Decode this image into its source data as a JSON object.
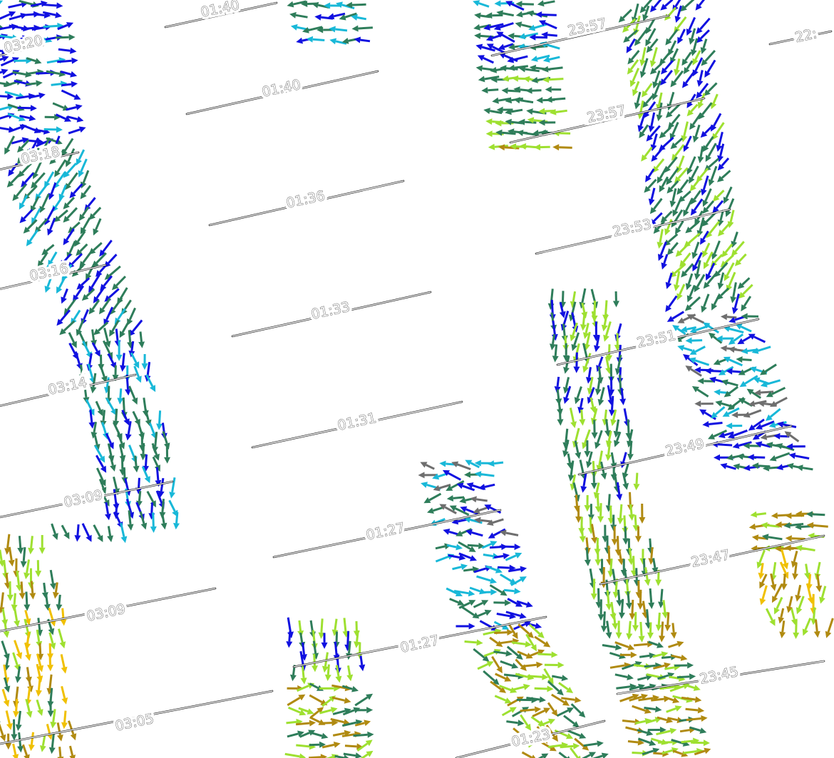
{
  "colors": {
    "blue": "#1010e0",
    "cyan": "#18b8d8",
    "green": "#2e7d5a",
    "lime": "#9ee030",
    "olive": "#b08a10",
    "yellow": "#f0c000",
    "gray": "#6e6e6e"
  },
  "tracks": [
    {
      "label": "03:20",
      "angle": -12
    },
    {
      "label": "03:18",
      "angle": -12
    },
    {
      "label": "03:16",
      "angle": -12
    },
    {
      "label": "03:14",
      "angle": -12
    },
    {
      "label": "03:09",
      "angle": -12
    },
    {
      "label": "03:09",
      "angle": -12
    },
    {
      "label": "03:05",
      "angle": -12
    },
    {
      "label": "01:40",
      "angle": -12
    },
    {
      "label": "01:40",
      "angle": -12
    },
    {
      "label": "01:36",
      "angle": -12
    },
    {
      "label": "01:33",
      "angle": -12
    },
    {
      "label": "01:31",
      "angle": -12
    },
    {
      "label": "01:27",
      "angle": -12
    },
    {
      "label": "01:27",
      "angle": -12
    },
    {
      "label": "01:23",
      "angle": -12
    },
    {
      "label": "23:57",
      "angle": -12
    },
    {
      "label": "23:57",
      "angle": -12
    },
    {
      "label": "23:53",
      "angle": -12
    },
    {
      "label": "23:51",
      "angle": -12
    },
    {
      "label": "23:49",
      "angle": -12
    },
    {
      "label": "23:47",
      "angle": -12
    },
    {
      "label": "23:45",
      "angle": -12
    },
    {
      "label": "22:",
      "angle": -12
    }
  ],
  "swaths": [
    {
      "name": "swath-left",
      "bands": [
        {
          "y": [
            0,
            200
          ],
          "dir": [
            -25,
            25
          ],
          "palette": [
            "blue",
            "blue",
            "cyan",
            "green"
          ]
        },
        {
          "y": [
            200,
            470
          ],
          "dir": [
            -140,
            -110
          ],
          "palette": [
            "green",
            "green",
            "blue",
            "cyan"
          ]
        },
        {
          "y": [
            470,
            760
          ],
          "dir": [
            -100,
            -60
          ],
          "palette": [
            "blue",
            "green",
            "green",
            "cyan"
          ]
        },
        {
          "y": [
            760,
            860
          ],
          "dir": [
            -100,
            -80
          ],
          "palette": [
            "lime",
            "olive",
            "green"
          ]
        },
        {
          "y": [
            860,
            1064
          ],
          "dir": [
            -100,
            -70
          ],
          "palette": [
            "green",
            "lime",
            "olive",
            "yellow"
          ]
        }
      ]
    },
    {
      "name": "swath-mid-top",
      "bands": [
        {
          "y": [
            0,
            80
          ],
          "dir": [
            160,
            200
          ],
          "palette": [
            "blue",
            "cyan",
            "green"
          ]
        }
      ]
    },
    {
      "name": "swath-center-top",
      "bands": [
        {
          "y": [
            0,
            90
          ],
          "dir": [
            150,
            200
          ],
          "palette": [
            "cyan",
            "green",
            "blue"
          ]
        },
        {
          "y": [
            90,
            200
          ],
          "dir": [
            170,
            190
          ],
          "palette": [
            "green",
            "green",
            "lime"
          ]
        },
        {
          "y": [
            200,
            225
          ],
          "dir": [
            170,
            190
          ],
          "palette": [
            "lime",
            "olive"
          ]
        }
      ]
    },
    {
      "name": "swath-right",
      "bands": [
        {
          "y": [
            0,
            440
          ],
          "dir": [
            -140,
            -100
          ],
          "palette": [
            "green",
            "green",
            "lime",
            "blue"
          ]
        },
        {
          "y": [
            440,
            620
          ],
          "dir": [
            140,
            220
          ],
          "palette": [
            "blue",
            "cyan",
            "green",
            "gray"
          ]
        },
        {
          "y": [
            620,
            740
          ],
          "dir": [
            160,
            200
          ],
          "palette": [
            "green",
            "blue"
          ]
        }
      ]
    },
    {
      "name": "swath-right-center",
      "bands": [
        {
          "y": [
            400,
            700
          ],
          "dir": [
            -110,
            -75
          ],
          "palette": [
            "green",
            "green",
            "lime",
            "blue"
          ]
        },
        {
          "y": [
            700,
            900
          ],
          "dir": [
            -95,
            -80
          ],
          "palette": [
            "lime",
            "olive",
            "green"
          ]
        },
        {
          "y": [
            900,
            1064
          ],
          "dir": [
            -20,
            20
          ],
          "palette": [
            "green",
            "lime",
            "olive"
          ]
        }
      ]
    },
    {
      "name": "swath-far-right",
      "bands": [
        {
          "y": [
            700,
            780
          ],
          "dir": [
            170,
            190
          ],
          "palette": [
            "lime",
            "green",
            "olive"
          ]
        },
        {
          "y": [
            780,
            900
          ],
          "dir": [
            -120,
            -60
          ],
          "palette": [
            "olive",
            "yellow",
            "lime"
          ]
        }
      ]
    },
    {
      "name": "swath-center-bottom",
      "bands": [
        {
          "y": [
            630,
            760
          ],
          "dir": [
            150,
            210
          ],
          "palette": [
            "green",
            "blue",
            "cyan",
            "gray"
          ]
        },
        {
          "y": [
            760,
            880
          ],
          "dir": [
            -40,
            30
          ],
          "palette": [
            "blue",
            "green",
            "cyan"
          ]
        },
        {
          "y": [
            880,
            1064
          ],
          "dir": [
            -60,
            30
          ],
          "palette": [
            "green",
            "lime",
            "olive"
          ]
        }
      ]
    },
    {
      "name": "swath-lower-mid",
      "bands": [
        {
          "y": [
            860,
            960
          ],
          "dir": [
            -100,
            -80
          ],
          "palette": [
            "green",
            "lime",
            "blue"
          ]
        },
        {
          "y": [
            960,
            1064
          ],
          "dir": [
            -30,
            40
          ],
          "palette": [
            "lime",
            "olive",
            "green"
          ]
        }
      ]
    }
  ]
}
